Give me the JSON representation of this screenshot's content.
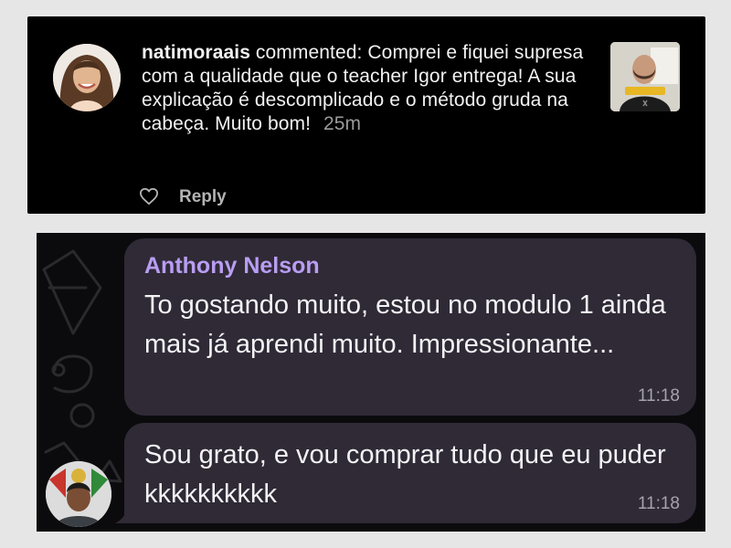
{
  "instagram_comment": {
    "username": "natimoraais",
    "action": "commented:",
    "comment": "Comprei e fiquei supresa com a qualidade que o teacher Igor entrega! A sua explicação é descomplicado e o método gruda na cabeça. Muito bom!",
    "time_ago": "25m",
    "reply_label": "Reply",
    "icons": [
      "heart-icon"
    ]
  },
  "telegram_chat": {
    "messages": [
      {
        "sender": "Anthony Nelson",
        "text": "To gostando muito, estou no modulo 1 ainda mais já aprendi muito. Impressionante...",
        "time": "11:18"
      },
      {
        "text": "Sou grato, e vou comprar tudo que eu puder kkkkkkkkkk",
        "time": "11:18"
      }
    ],
    "colors": {
      "bubble": "#2f2a36",
      "sender_name": "#b99df2",
      "background": "#0b0b0d"
    }
  }
}
